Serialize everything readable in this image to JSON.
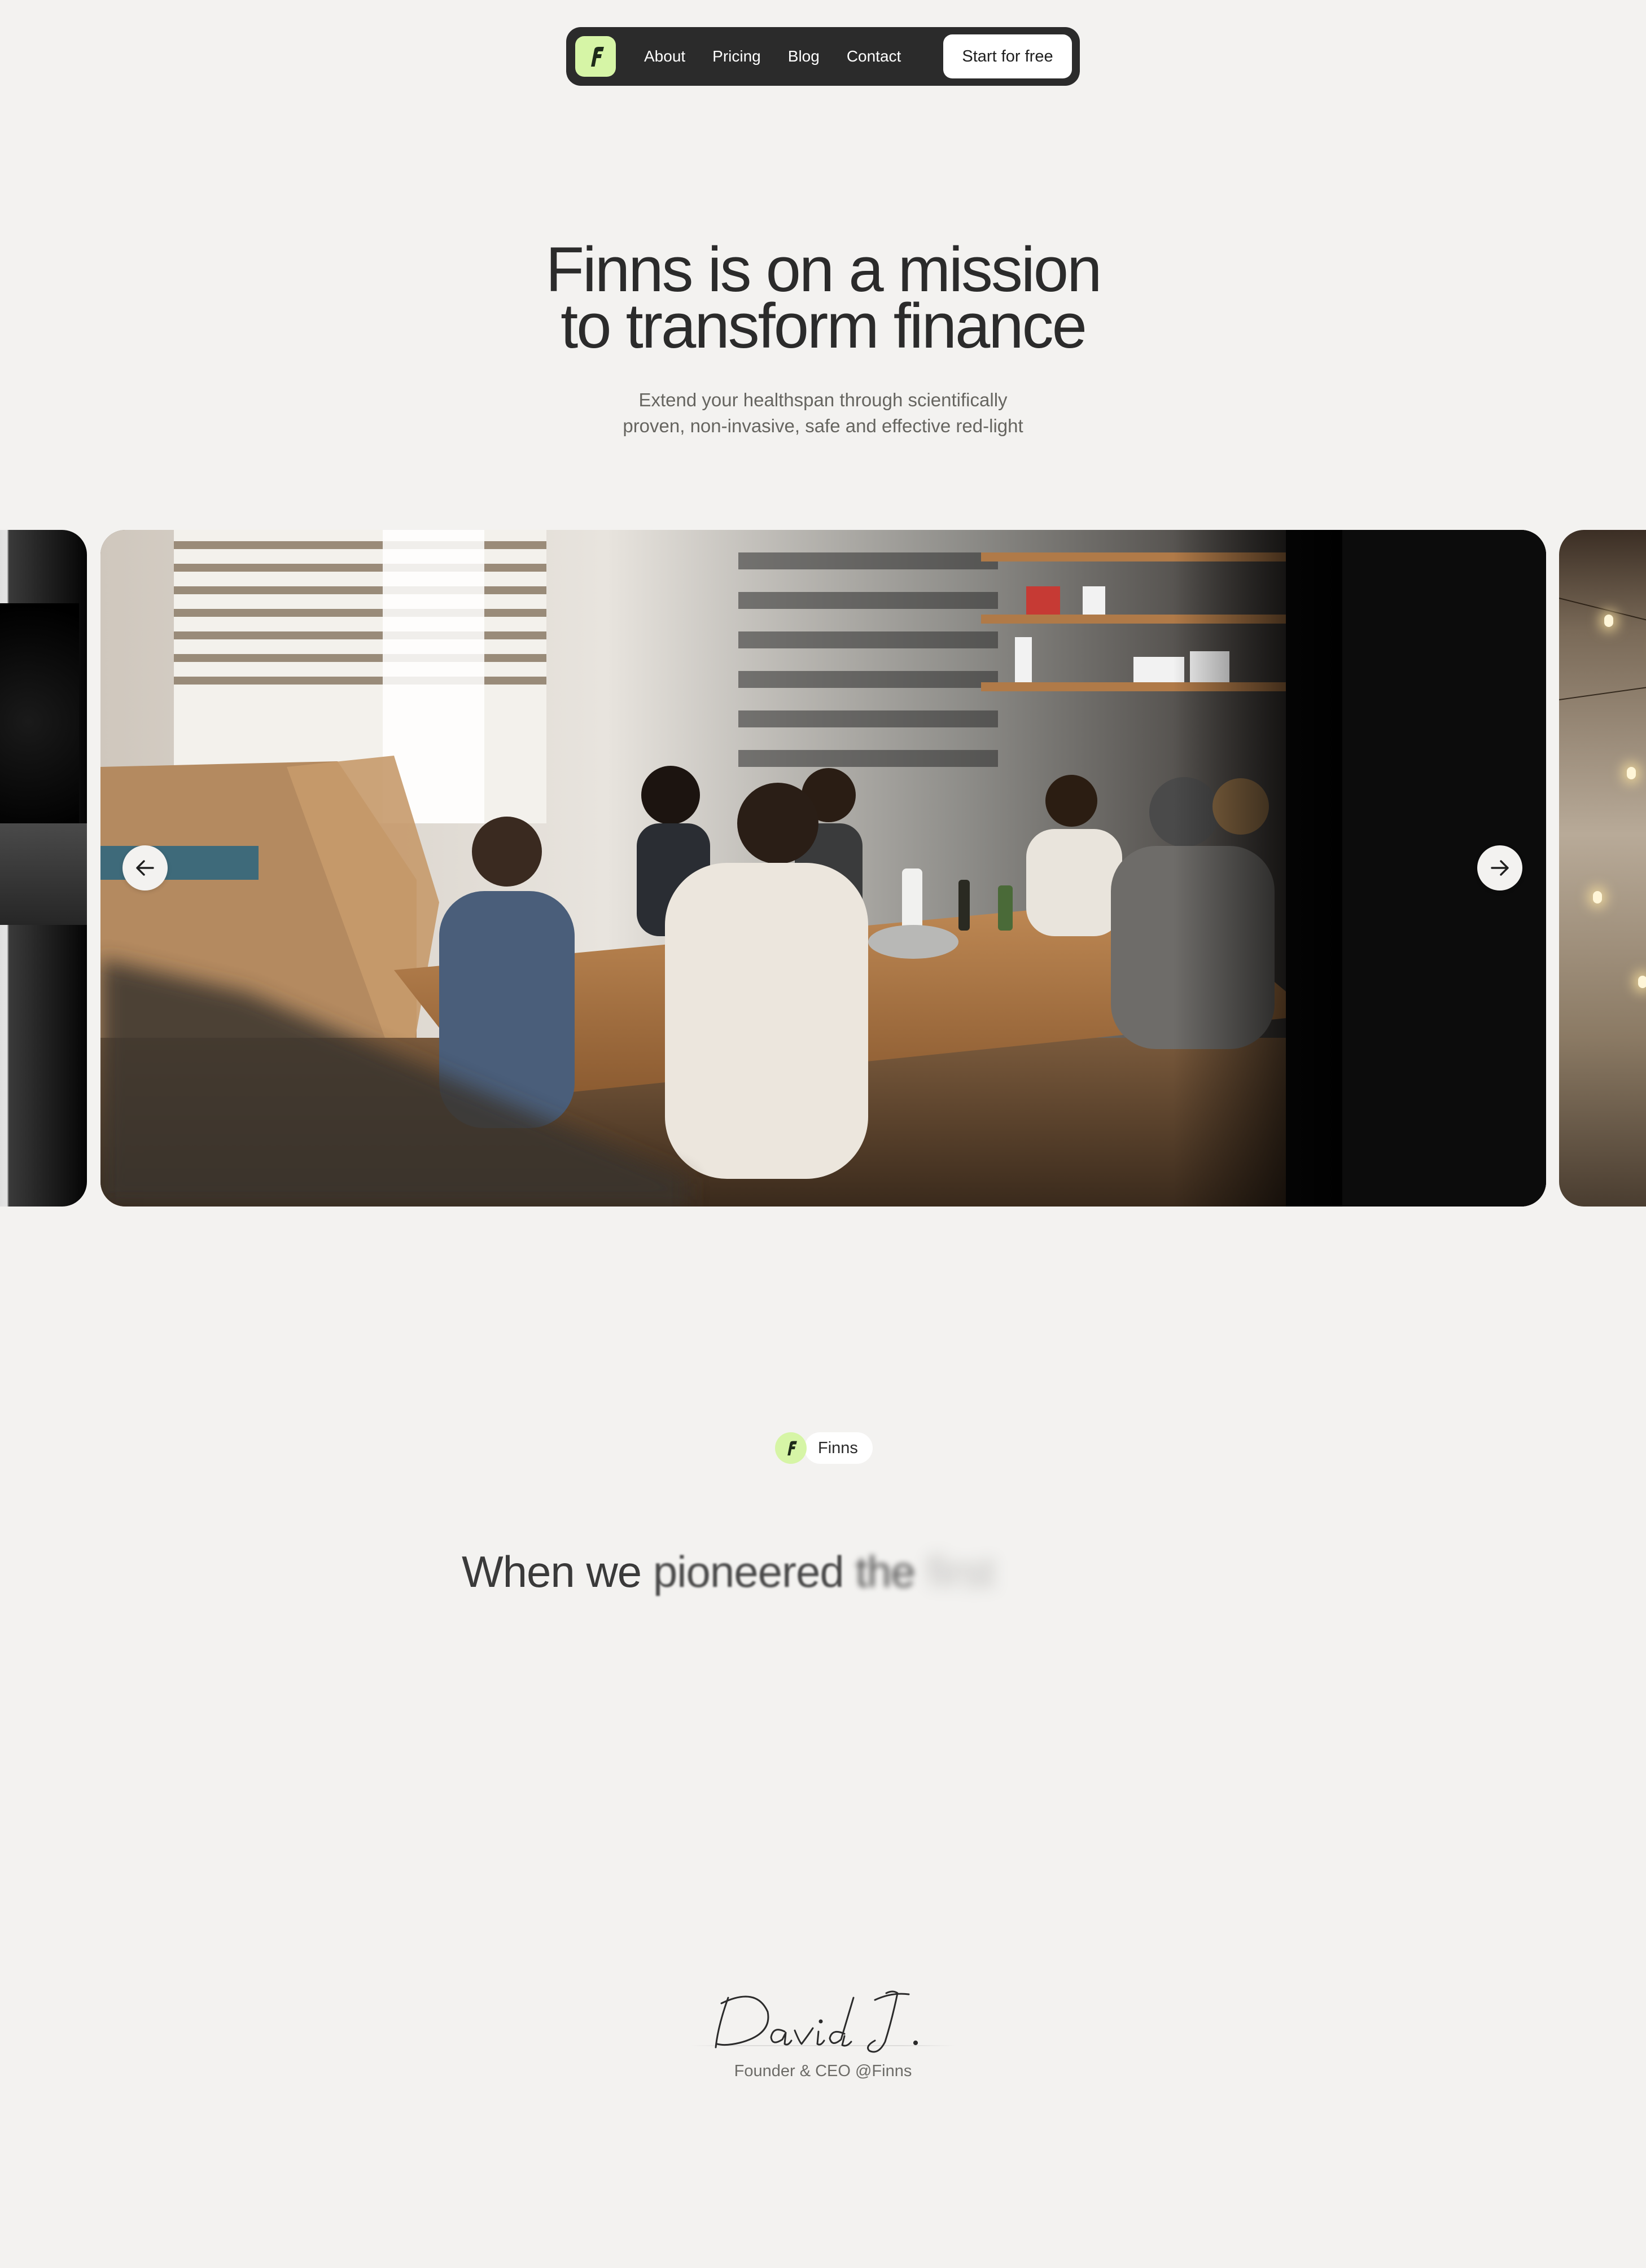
{
  "nav": {
    "logo_icon": "finns-f-logo",
    "links": [
      {
        "label": "About"
      },
      {
        "label": "Pricing"
      },
      {
        "label": "Blog"
      },
      {
        "label": "Contact"
      }
    ],
    "cta_label": "Start for free"
  },
  "hero": {
    "title_lines": [
      "Finns is on a mission",
      "to transform finance"
    ],
    "subtitle_lines": [
      "Extend your healthspan through scientifically",
      "proven, non-invasive, safe and effective red-light"
    ]
  },
  "carousel": {
    "prev_icon": "arrow-left-icon",
    "next_icon": "arrow-right-icon"
  },
  "about": {
    "badge_label": "Finns",
    "statement_words": [
      "When",
      "we",
      "pioneered",
      "the",
      "first"
    ]
  },
  "signature": {
    "name": "David J.",
    "role": "Founder & CEO @Finns"
  },
  "colors": {
    "background": "#f3f2f0",
    "nav_background": "#2b2b2b",
    "accent_green": "#d6f5a6",
    "text_dark": "#2b2b2b",
    "text_muted": "#666560"
  }
}
